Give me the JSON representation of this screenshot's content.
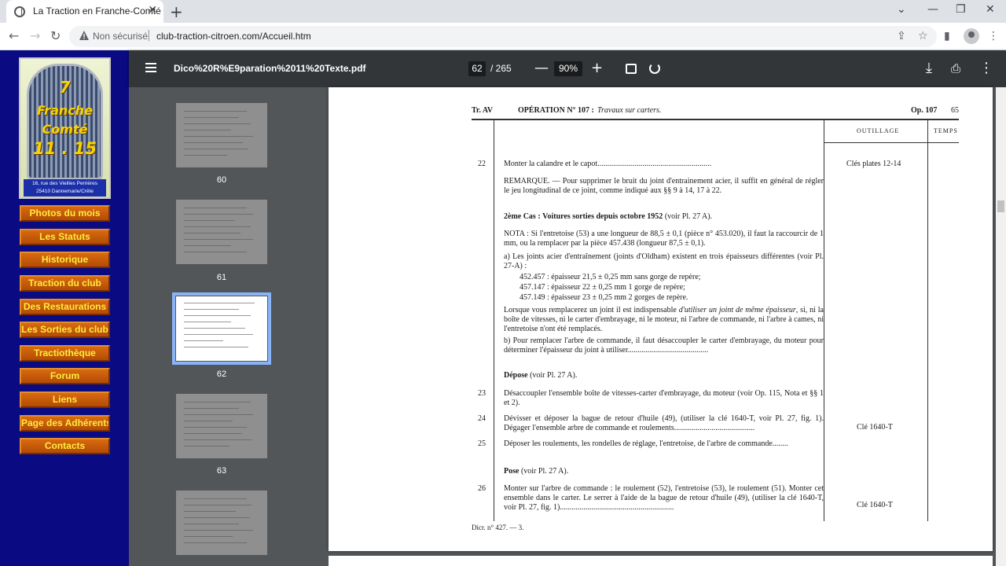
{
  "browser": {
    "tab_title": "La Traction en Franche-Comté",
    "new_tab": "+",
    "security_label": "Non sécurisé",
    "url": "club-traction-citroen.com/Accueil.htm"
  },
  "site": {
    "logo": {
      "line1": "7",
      "line2": "Franche",
      "line3": "Comté",
      "line4": "11 . 15",
      "address_line1": "16, rue des Vieilles Perrières",
      "address_line2": "25410 Dannemarie/Crête"
    },
    "nav": [
      "Photos du mois",
      "Les Statuts",
      "Historique",
      "Traction du club",
      "Des Restaurations",
      "Les Sorties du club",
      "Tractiothèque",
      "Forum",
      "Liens",
      "Page des Adhérents",
      "Contacts"
    ]
  },
  "pdf": {
    "filename": "Dico%20R%E9paration%2011%20Texte.pdf",
    "current_page": "62",
    "total_pages": "/ 265",
    "zoom": "90%",
    "thumbnails": [
      "60",
      "61",
      "62",
      "63"
    ],
    "selected_thumbnail": "62"
  },
  "document": {
    "header_left": "Tr. AV",
    "header_op": "OPÉRATION N° 107 :",
    "header_title": "Travaux sur carters.",
    "header_right": "Op. 107",
    "page_number": "65",
    "col_tools": "OUTILLAGE",
    "col_time": "TEMPS",
    "footer": "Dicr. n° 427. — 3.",
    "steps": {
      "s22_num": "22",
      "s22_text": "Monter la calandre et le capot..........................................................",
      "s22_tool": "Clés plates 12-14",
      "remarque": "REMARQUE. — Pour supprimer le bruit du joint d'entrainement acier, il suffit en général de régler le jeu longitudinal de ce joint, comme indiqué aux §§ 9 à 14, 17 à 22.",
      "cas2_prefix": "2ème Cas :",
      "cas2_title": "Voitures sorties depuis octobre 1952",
      "cas2_ref": "(voir Pl. 27 A).",
      "nota": "NOTA : Si l'entretoise (53) a une longueur de 88,5 ± 0,1 (pièce n° 453.020), il faut la raccourcir de 1 mm, ou la remplacer par la pièce 457.438 (longueur 87,5 ± 0,1).",
      "a_text": "a) Les joints acier d'entraînement (joints d'Oldham) existent en trois épaisseurs différentes (voir Pl. 27-A) :",
      "a_1": "452.457 : épaisseur 21,5 ± 0,25 mm sans gorge de repère;",
      "a_2": "457.147 : épaisseur 22 ± 0,25 mm 1 gorge de repère;",
      "a_3": "457.149 : épaisseur 23 ± 0,25 mm 2 gorges de repère.",
      "lorsque_a": "Lorsque vous remplacerez un joint il est indispensable",
      "lorsque_i": "d'utiliser un joint de même épaisseur",
      "lorsque_b": ", si, ni la boîte de vitesses, ni le carter d'embrayage, ni le moteur, ni l'arbre de commande, ni l'arbre à cames, ni l'entretoise n'ont été remplacés.",
      "b_text": "b) Pour remplacer l'arbre de commande, il faut désaccoupler le carter d'embrayage, du moteur pour déterminer l'épaisseur du joint à utiliser.........................................",
      "depose_title": "Dépose",
      "depose_ref": "(voir Pl. 27 A).",
      "s23_num": "23",
      "s23_text": "Désaccoupler l'ensemble boîte de vitesses-carter d'embrayage, du moteur (voir Op. 115, Nota et §§ 1 et 2).",
      "s24_num": "24",
      "s24_text": "Dévisser et déposer la bague de retour d'huile (49), (utiliser la clé 1640-T, voir Pl. 27, fig. 1). Dégager l'ensemble arbre de commande et roulements.........................................",
      "s24_tool": "Clé 1640-T",
      "s25_num": "25",
      "s25_text": "Déposer les roulements, les rondelles de réglage, l'entretoise, de l'arbre de commande........",
      "pose_title": "Pose",
      "pose_ref": "(voir Pl. 27 A).",
      "s26_num": "26",
      "s26_text": "Monter sur l'arbre de commande : le roulement (52), l'entretoise (53), le roulement (51). Monter cet ensemble dans le carter. Le serrer à l'aide de la bague de retour d'huile (49), (utiliser la clé 1640-T, voir Pl. 27, fig. 1)..........................................................",
      "s26_tool": "Clé 1640-T"
    }
  }
}
